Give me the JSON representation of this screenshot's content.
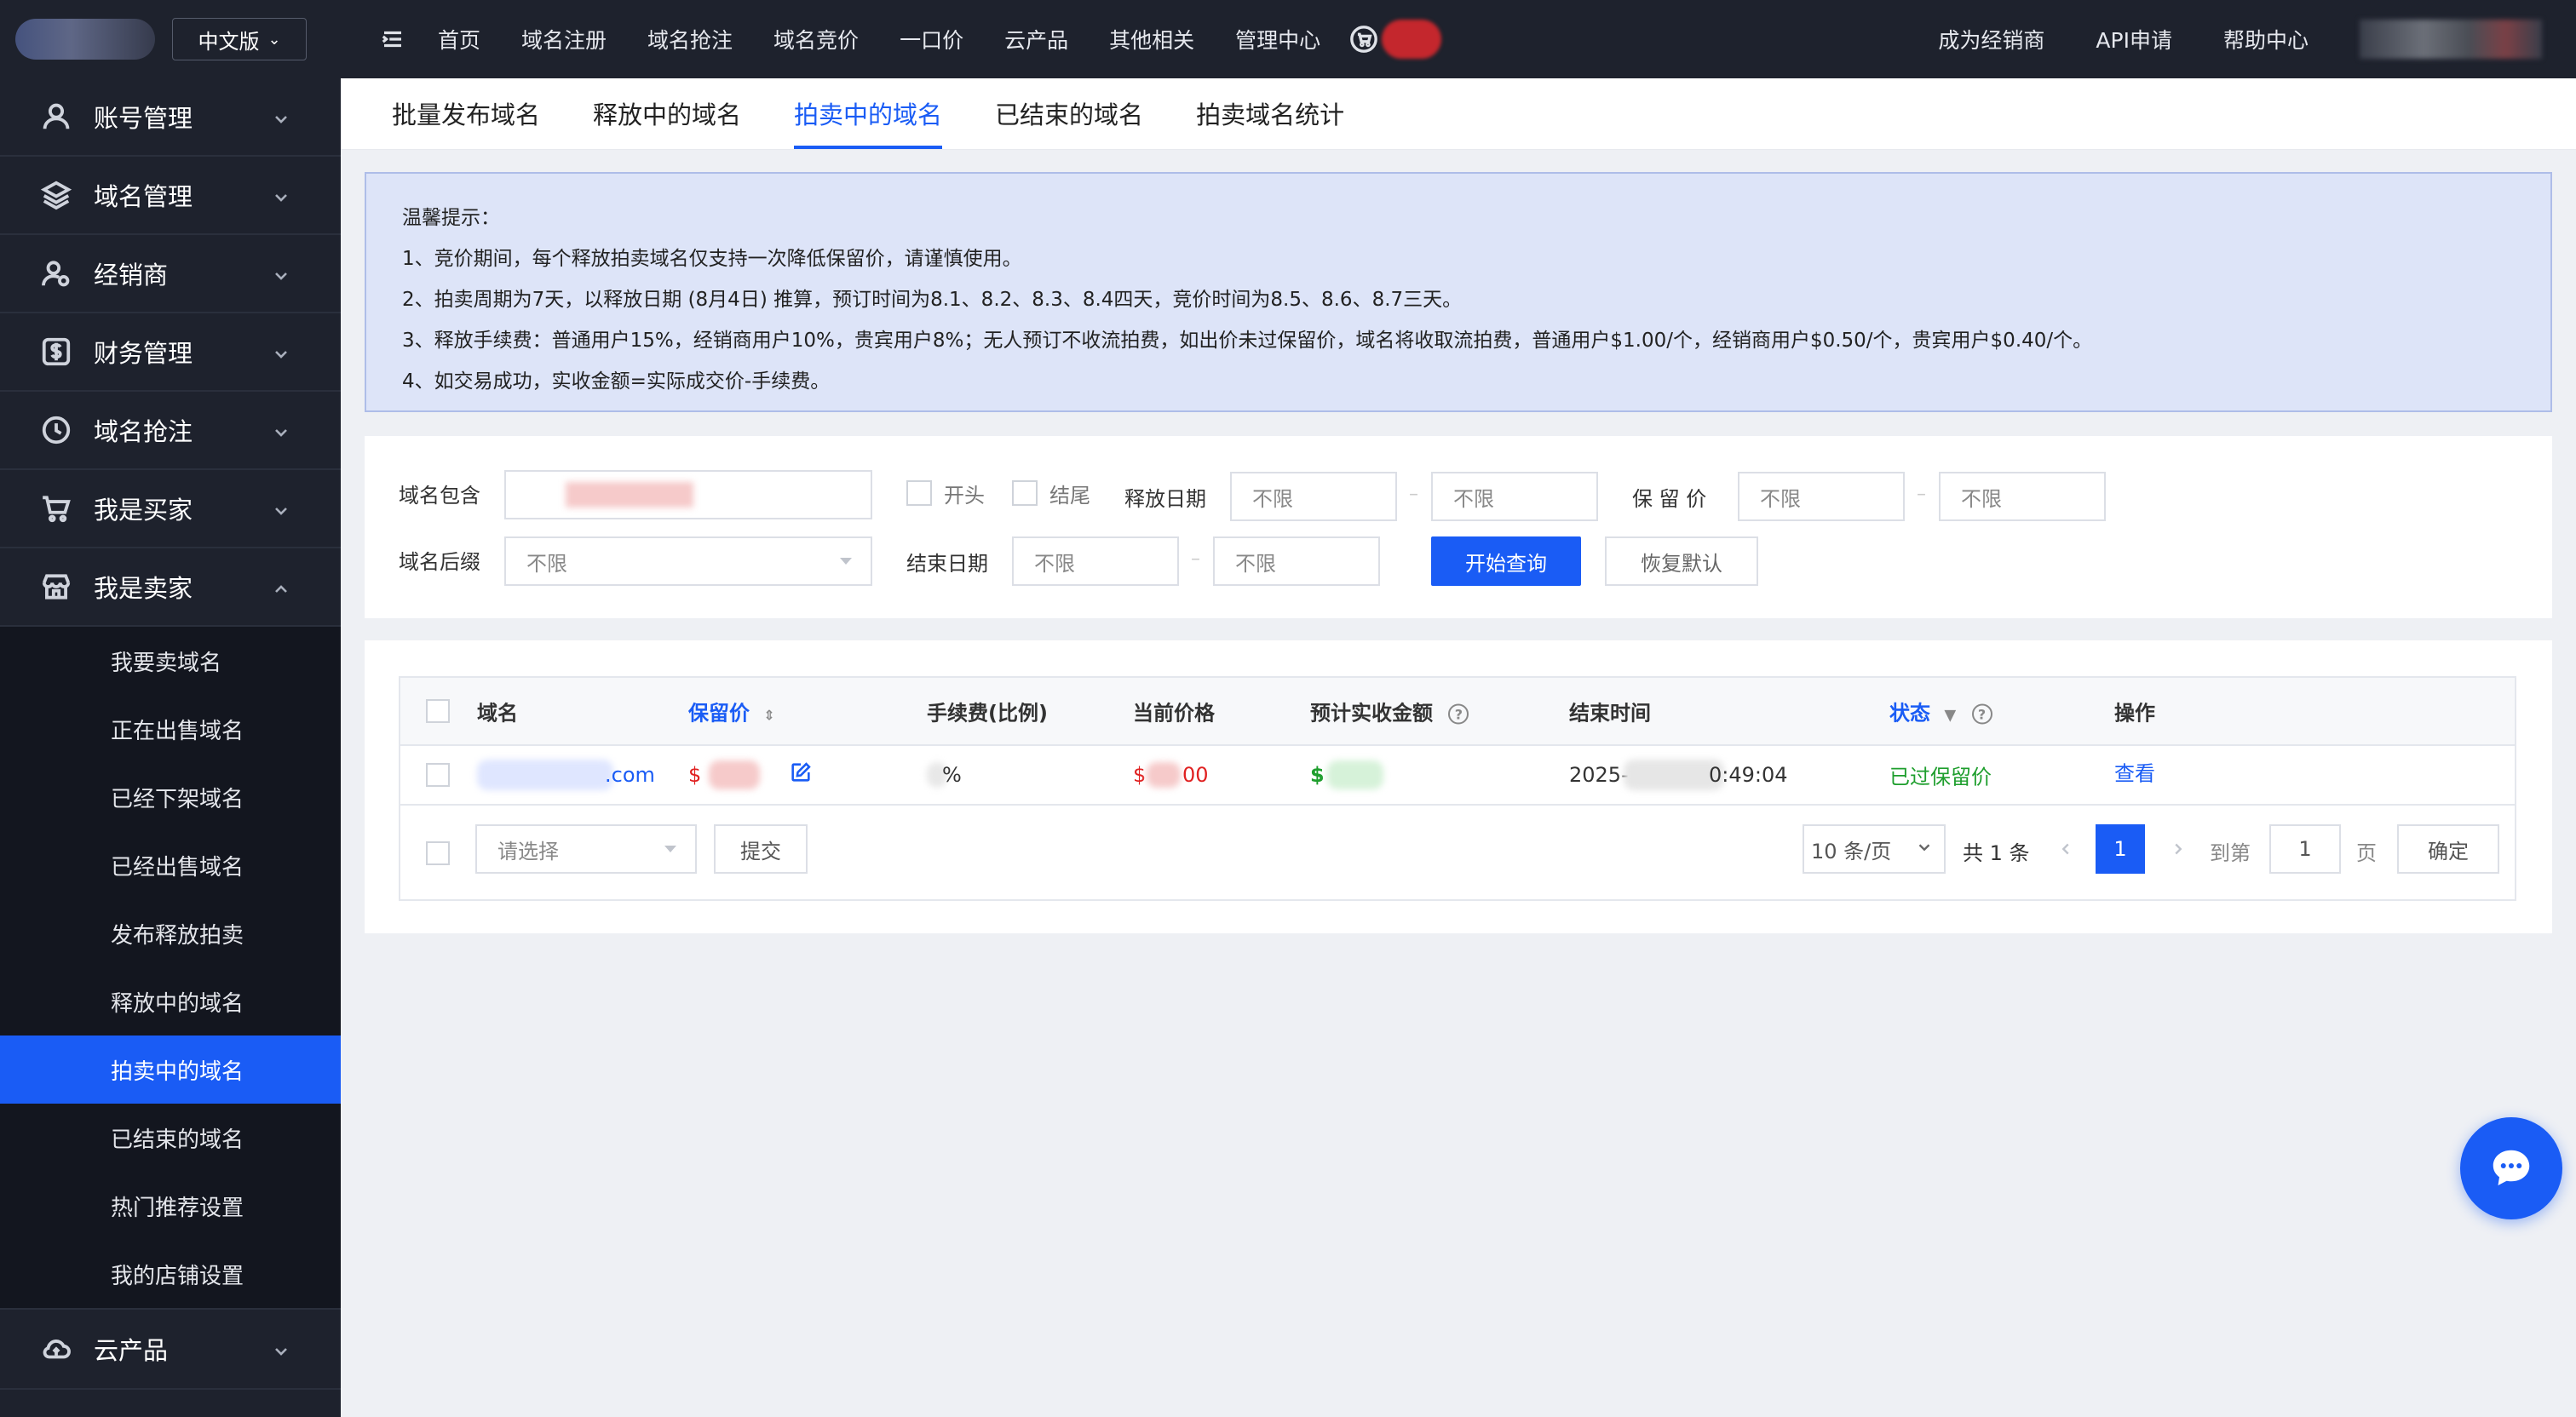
{
  "lang": "中文版",
  "topnav": {
    "links": [
      "首页",
      "域名注册",
      "域名抢注",
      "域名竞价",
      "一口价",
      "云产品",
      "其他相关",
      "管理中心"
    ],
    "right_links": [
      "成为经销商",
      "API申请",
      "帮助中心"
    ]
  },
  "sidebar": {
    "items": [
      {
        "label": "账号管理",
        "icon": "user-icon"
      },
      {
        "label": "域名管理",
        "icon": "layers-icon"
      },
      {
        "label": "经销商",
        "icon": "user-gear-icon"
      },
      {
        "label": "财务管理",
        "icon": "dollar-icon"
      },
      {
        "label": "域名抢注",
        "icon": "clock-icon"
      },
      {
        "label": "我是买家",
        "icon": "cart-icon"
      },
      {
        "label": "我是卖家",
        "icon": "store-icon"
      }
    ],
    "submenu": [
      "我要卖域名",
      "正在出售域名",
      "已经下架域名",
      "已经出售域名",
      "发布释放拍卖",
      "释放中的域名",
      "拍卖中的域名",
      "已结束的域名",
      "热门推荐设置",
      "我的店铺设置"
    ],
    "bottom_item": {
      "label": "云产品",
      "icon": "cloud-icon"
    }
  },
  "tabs": [
    "批量发布域名",
    "释放中的域名",
    "拍卖中的域名",
    "已结束的域名",
    "拍卖域名统计"
  ],
  "notice": {
    "title": "温馨提示：",
    "lines": [
      "1、竞价期间，每个释放拍卖域名仅支持一次降低保留价，请谨慎使用。",
      "2、拍卖周期为7天，以释放日期 (8月4日) 推算，预订时间为8.1、8.2、8.3、8.4四天，竞价时间为8.5、8.6、8.7三天。",
      "3、释放手续费：普通用户15%，经销商用户10%，贵宾用户8%；无人预订不收流拍费，如出价未过保留价，域名将收取流拍费，普通用户$1.00/个，经销商用户$0.50/个，贵宾用户$0.40/个。",
      "4、如交易成功，实收金额=实际成交价-手续费。"
    ]
  },
  "filter": {
    "domain_contains": "域名包含",
    "start": "开头",
    "end": "结尾",
    "release_date": "释放日期",
    "reserve_price": "保 留 价",
    "suffix": "域名后缀",
    "end_date": "结束日期",
    "unlimited": "不限",
    "search_btn": "开始查询",
    "reset_btn": "恢复默认"
  },
  "table": {
    "headers": {
      "domain": "域名",
      "reserve": "保留价",
      "fee": "手续费(比例)",
      "current": "当前价格",
      "estimate": "预计实收金额",
      "end_time": "结束时间",
      "status": "状态",
      "action": "操作"
    },
    "row": {
      "domain_tail": ".com",
      "reserve_prefix": "$",
      "fee_suffix": "%",
      "current_prefix": "$",
      "current_tail": "00",
      "estimate_prefix": "$",
      "end_time_head": "2025-",
      "end_time_tail": "0:49:04",
      "status": "已过保留价",
      "action": "查看"
    }
  },
  "footer": {
    "select_placeholder": "请选择",
    "submit": "提交",
    "page_size": "10 条/页",
    "total": "共 1 条",
    "current_page": "1",
    "goto": "到第",
    "goto_value": "1",
    "page_unit": "页",
    "confirm": "确定"
  },
  "colors": {
    "accent": "#1a5cf5",
    "sidebar_bg": "#1e222d",
    "status_green": "#1e9e2d",
    "price_red": "#e02020"
  }
}
